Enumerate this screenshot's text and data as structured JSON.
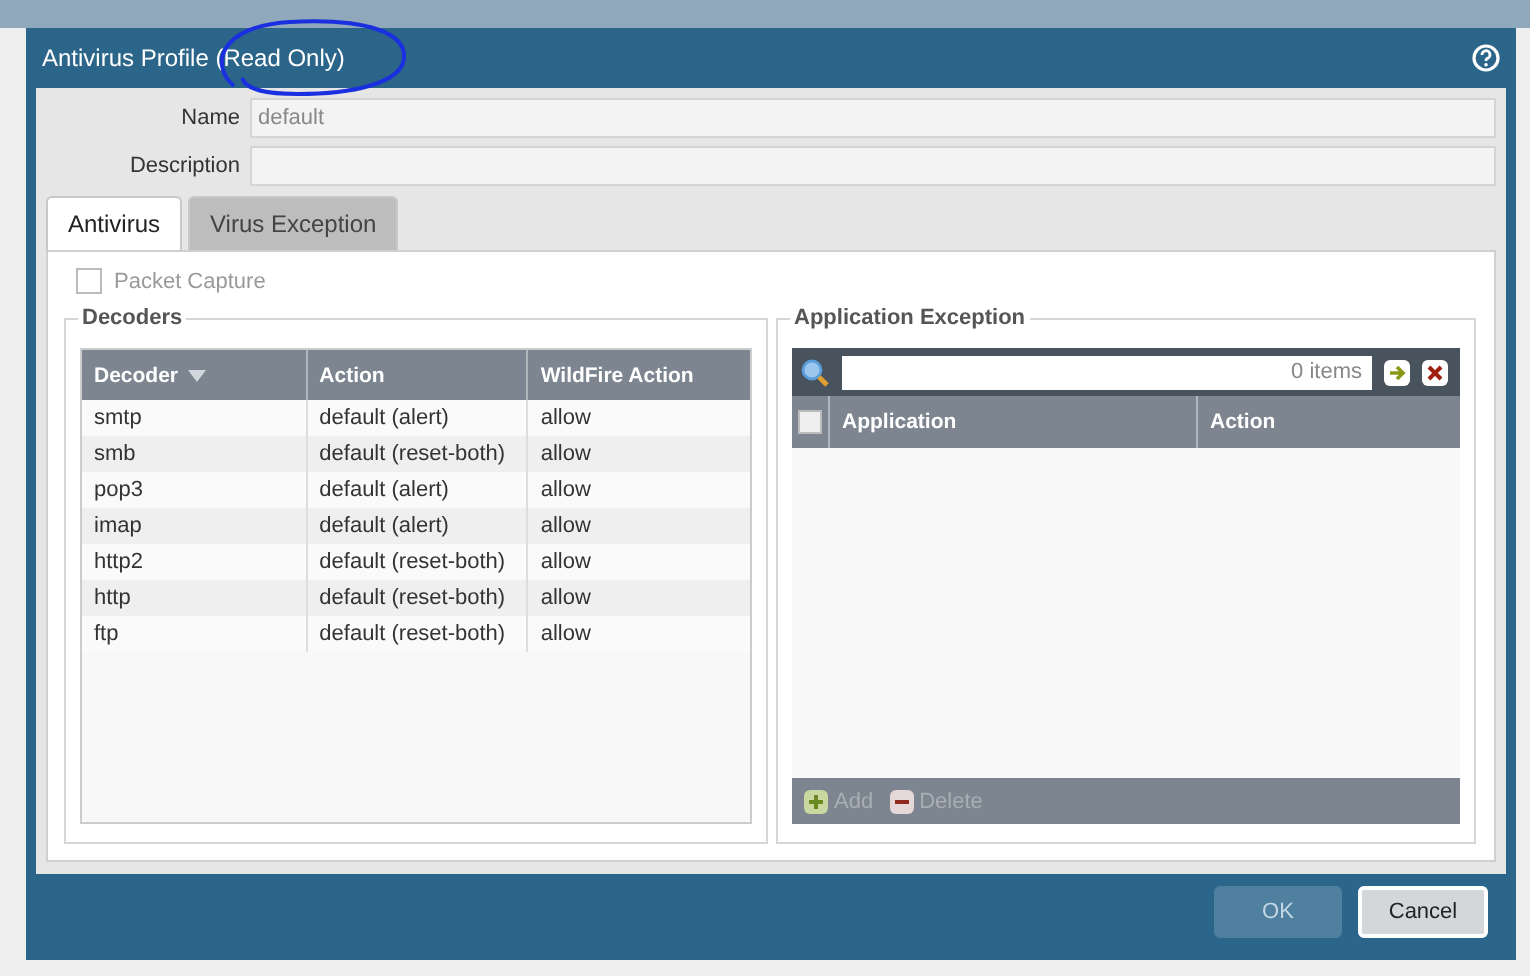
{
  "dialog": {
    "title": "Antivirus Profile (Read Only)",
    "fields": [
      {
        "label": "Name",
        "value": "default"
      },
      {
        "label": "Description"
      }
    ],
    "tabs": [
      {
        "label": "Antivirus",
        "selected": true
      },
      {
        "label": "Virus Exception",
        "selected": false
      }
    ],
    "packet_capture": {
      "label": "Packet Capture",
      "checked": false
    },
    "decoders": {
      "title": "Decoders",
      "columns": [
        {
          "label": "Decoder",
          "sorted": true
        },
        {
          "label": "Action",
          "sorted": false
        },
        {
          "label": "WildFire Action",
          "sorted": false
        }
      ],
      "rows": [
        [
          "smtp",
          "default (alert)",
          "allow"
        ],
        [
          "smb",
          "default (reset-both)",
          "allow"
        ],
        [
          "pop3",
          "default (alert)",
          "allow"
        ],
        [
          "imap",
          "default (alert)",
          "allow"
        ],
        [
          "http2",
          "default (reset-both)",
          "allow"
        ],
        [
          "http",
          "default (reset-both)",
          "allow"
        ],
        [
          "ftp",
          "default (reset-both)",
          "allow"
        ]
      ]
    },
    "application_exception": {
      "title": "Application Exception",
      "count": "0 items",
      "select_all": {
        "checked": false
      },
      "columns": [
        {
          "label": "Application"
        },
        {
          "label": "Action"
        }
      ],
      "actions": [
        {
          "label": "Add",
          "kind": "add",
          "disabled": true
        },
        {
          "label": "Delete",
          "kind": "delete",
          "disabled": true
        }
      ]
    },
    "buttons": [
      {
        "label": "OK",
        "disabled": true
      },
      {
        "label": "Cancel",
        "disabled": false
      }
    ]
  }
}
